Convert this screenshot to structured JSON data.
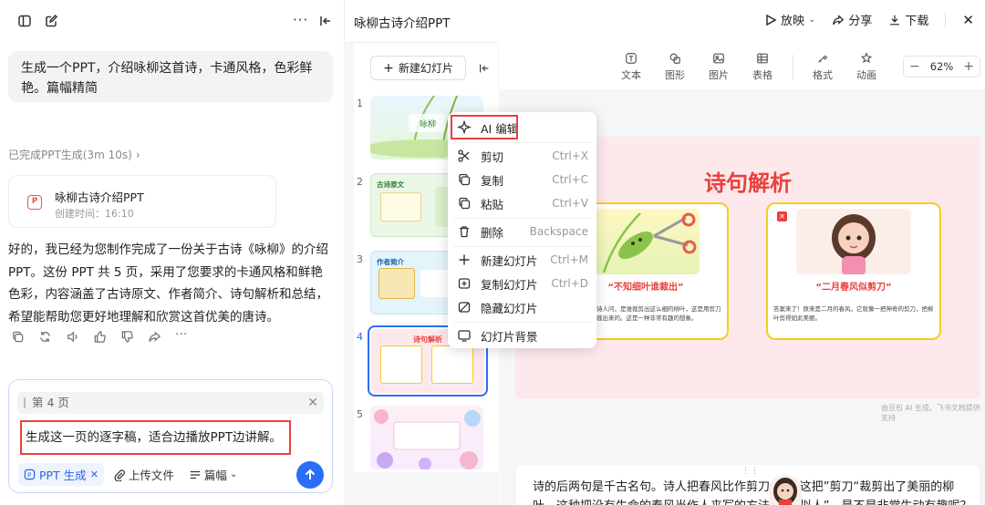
{
  "chat": {
    "user_message": "生成一个PPT，介绍咏柳这首诗，卡通风格，色彩鲜艳。篇幅精简",
    "status": "已完成PPT生成(3m 10s)",
    "card": {
      "title": "咏柳古诗介绍PPT",
      "created": "创建时间：16:10"
    },
    "reply": "好的，我已经为您制作完成了一份关于古诗《咏柳》的介绍 PPT。这份 PPT 共 5 页，采用了您要求的卡通风格和鲜艳色彩，内容涵盖了古诗原文、作者简介、诗句解析和总结，希望能帮助您更好地理解和欣赏这首优美的唐诗。"
  },
  "composer": {
    "context": "第 4 页",
    "prompt": "生成这一页的逐字稿，适合边播放PPT边讲解。",
    "chip_ppt": "PPT 生成",
    "upload": "上传文件",
    "length": "篇幅"
  },
  "header": {
    "doc_title": "咏柳古诗介绍PPT",
    "play": "放映",
    "share": "分享",
    "download": "下载"
  },
  "slides_panel": {
    "new_slide": "新建幻灯片",
    "numbers": [
      "1",
      "2",
      "3",
      "4",
      "5"
    ],
    "thumb_texts": {
      "s1_title": "咏柳",
      "s2_title": "古诗原文",
      "s3_title": "作者简介",
      "s4_title": "诗句解析"
    }
  },
  "toolbar": {
    "tools": [
      "文本",
      "图形",
      "图片",
      "表格",
      "格式",
      "动画"
    ],
    "zoom": "62%"
  },
  "slide": {
    "title": "诗句解析",
    "left_caption": "“不知细叶谁裁出”",
    "left_body": "诗人问，是谁裁剪出这么细的柳叶，这是用剪刀裁出来的。这是一种非常有趣的想象。",
    "right_caption": "“二月春风似剪刀”",
    "right_body": "答案来了！原来是二月的春风，它就像一把神奇的剪刀，把柳叶剪得如此美丽。",
    "watermark": "由豆包 AI 生成，飞书文档提供支持"
  },
  "notes": {
    "line1": "诗的后两句是千古名句。诗人把春风比作剪刀，说“这把”剪刀“裁剪出了美丽的柳",
    "line2": "叶。这种把没有生命的春风当作人来写的方法，叫“拟人”，是不是非常生动有趣呢？"
  },
  "context_menu": {
    "items": [
      {
        "label": "AI 编辑",
        "shortcut": ""
      },
      {
        "label": "剪切",
        "shortcut": "Ctrl+X"
      },
      {
        "label": "复制",
        "shortcut": "Ctrl+C"
      },
      {
        "label": "粘贴",
        "shortcut": "Ctrl+V"
      },
      {
        "label": "删除",
        "shortcut": "Backspace"
      },
      {
        "label": "新建幻灯片",
        "shortcut": "Ctrl+M"
      },
      {
        "label": "复制幻灯片",
        "shortcut": "Ctrl+D"
      },
      {
        "label": "隐藏幻灯片",
        "shortcut": ""
      },
      {
        "label": "幻灯片背景",
        "shortcut": ""
      }
    ]
  },
  "colors": {
    "accent": "#2b6ef5",
    "highlight": "#e8413c",
    "slide_title": "#e8413c",
    "card_border": "#f5cd1f"
  }
}
